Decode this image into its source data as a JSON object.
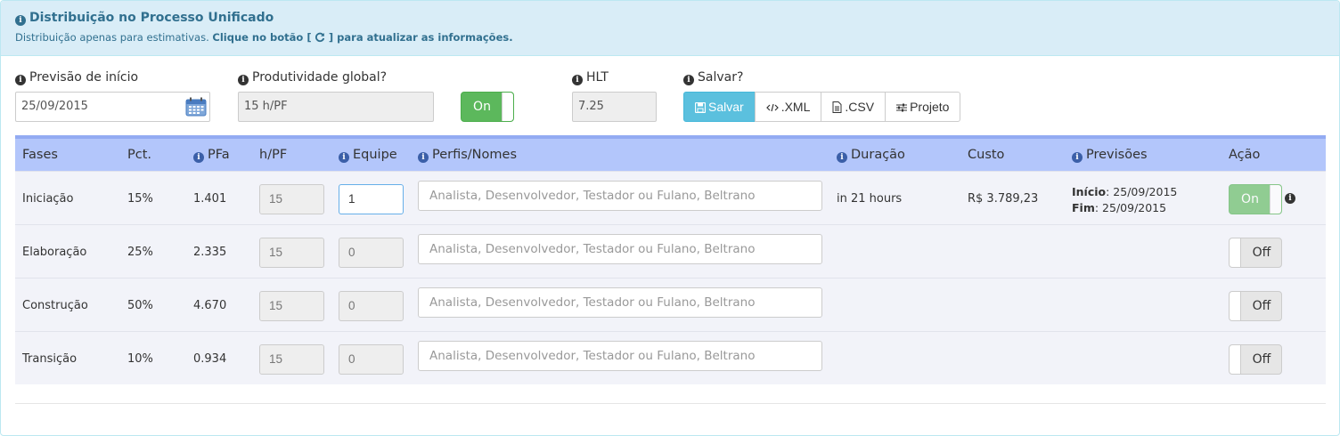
{
  "header": {
    "title": "Distribuição no Processo Unificado",
    "subtitle_prefix": "Distribuição apenas para estimativas.",
    "subtitle_bold_start": "Clique no botão [",
    "subtitle_bold_end": "] para atualizar as informações."
  },
  "form": {
    "previsao_label": "Previsão de início",
    "previsao_value": "25/09/2015",
    "produtividade_label": "Produtividade global?",
    "produtividade_value": "15 h/PF",
    "produtividade_toggle": "On",
    "hlt_label": "HLT",
    "hlt_value": "7.25",
    "salvar_label": "Salvar?",
    "buttons": {
      "salvar": "Salvar",
      "xml": ".XML",
      "csv": ".CSV",
      "projeto": "Projeto"
    }
  },
  "table": {
    "headers": {
      "fases": "Fases",
      "pct": "Pct.",
      "pfa": "PFa",
      "hpf": "h/PF",
      "equipe": "Equipe",
      "perfis": "Perfis/Nomes",
      "duracao": "Duração",
      "custo": "Custo",
      "previsoes": "Previsões",
      "acao": "Ação"
    },
    "placeholder": "Analista, Desenvolvedor, Testador ou Fulano, Beltrano",
    "rows": [
      {
        "fase": "Iniciação",
        "pct": "15%",
        "pfa": "1.401",
        "hpf": "15",
        "equipe": "1",
        "duracao": "in 21 hours",
        "custo": "R$ 3.789,23",
        "inicio_label": "Início",
        "inicio": ": 25/09/2015",
        "fim_label": "Fim",
        "fim": ": 25/09/2015",
        "acao": "On"
      },
      {
        "fase": "Elaboração",
        "pct": "25%",
        "pfa": "2.335",
        "hpf": "15",
        "equipe": "0",
        "acao": "Off"
      },
      {
        "fase": "Construção",
        "pct": "50%",
        "pfa": "4.670",
        "hpf": "15",
        "equipe": "0",
        "acao": "Off"
      },
      {
        "fase": "Transição",
        "pct": "10%",
        "pfa": "0.934",
        "hpf": "15",
        "equipe": "0",
        "acao": "Off"
      }
    ]
  },
  "colors": {
    "header_bg": "#d9edf7",
    "header_text": "#31708f",
    "table_header_bg": "#b3c6fb",
    "toggle_on": "#5cb85c",
    "primary_button": "#5bc0de"
  }
}
